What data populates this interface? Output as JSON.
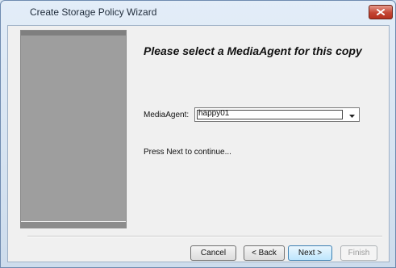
{
  "window": {
    "title": "Create Storage Policy Wizard"
  },
  "main": {
    "heading": "Please select a MediaAgent for this copy",
    "media_agent_label": "MediaAgent:",
    "media_agent_value": "happy01",
    "hint": "Press Next to continue..."
  },
  "buttons": {
    "cancel": "Cancel",
    "back": "< Back",
    "next": "Next >",
    "finish": "Finish"
  },
  "icons": {
    "close": "close-icon",
    "dropdown": "chevron-down-icon"
  }
}
